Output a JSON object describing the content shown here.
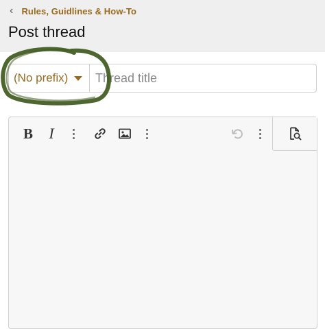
{
  "breadcrumb": {
    "back_icon": "chevron-left-icon",
    "label": "Rules, Guidlines & How-To"
  },
  "page": {
    "title": "Post thread"
  },
  "form": {
    "prefix": {
      "value": "(No prefix)",
      "icon": "caret-down-icon"
    },
    "thread_title": {
      "placeholder": "Thread title",
      "value": ""
    }
  },
  "toolbar": {
    "buttons": [
      {
        "name": "bold",
        "label": "B"
      },
      {
        "name": "italic",
        "label": "I"
      },
      {
        "name": "more",
        "icon": "more-vertical-icon"
      },
      {
        "name": "link",
        "icon": "link-icon"
      },
      {
        "name": "image",
        "icon": "image-icon"
      },
      {
        "name": "more",
        "icon": "more-vertical-icon"
      },
      {
        "name": "undo",
        "icon": "undo-icon"
      },
      {
        "name": "more",
        "icon": "more-vertical-icon"
      },
      {
        "name": "preview",
        "icon": "preview-icon"
      }
    ]
  },
  "colors": {
    "accent": "#9a6a1e",
    "header_bg": "#efefef",
    "editor_bg": "#f7f7f7",
    "annotation": "#3f5a1e"
  }
}
